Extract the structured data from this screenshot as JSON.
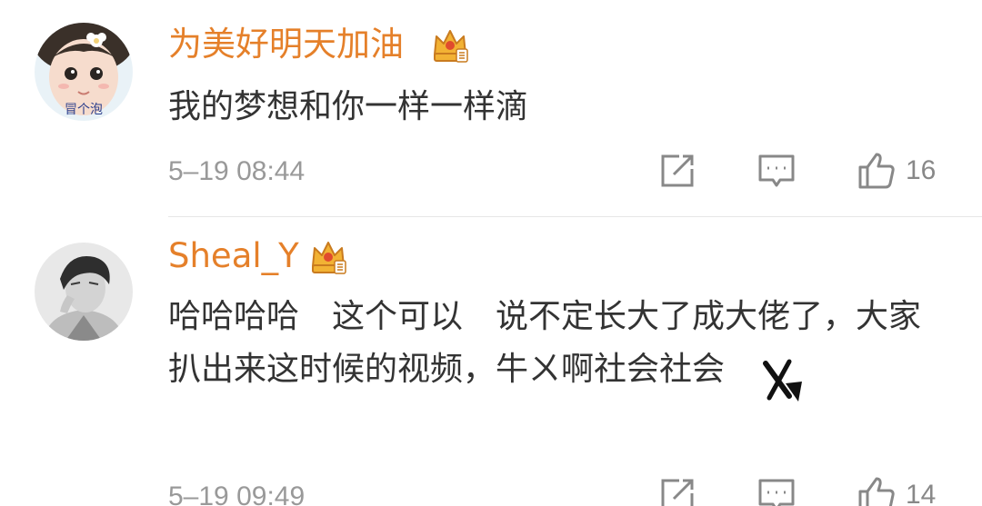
{
  "comments": [
    {
      "username": "为美好明天加油",
      "text": "我的梦想和你一样一样滴",
      "timestamp": "5–19 08:44",
      "likes": "16",
      "avatar_caption": "冒个泡",
      "badge_icon": "vip-crown-icon"
    },
    {
      "username": "Sheal_Y",
      "text": "哈哈哈哈　这个可以　说不定长大了成大佬了，大家扒出来这时候的视频，牛ㄨ啊社会社会",
      "timestamp": "5–19 09:49",
      "likes": "14",
      "badge_icon": "vip-crown-icon"
    }
  ],
  "actions": {
    "share_icon": "share-icon",
    "reply_icon": "comment-icon",
    "like_icon": "thumbs-up-icon"
  },
  "colors": {
    "username": "#e5802a",
    "body_text": "#333333",
    "meta_text": "#999999",
    "icon_stroke": "#888888",
    "divider": "#e6e6e6"
  }
}
